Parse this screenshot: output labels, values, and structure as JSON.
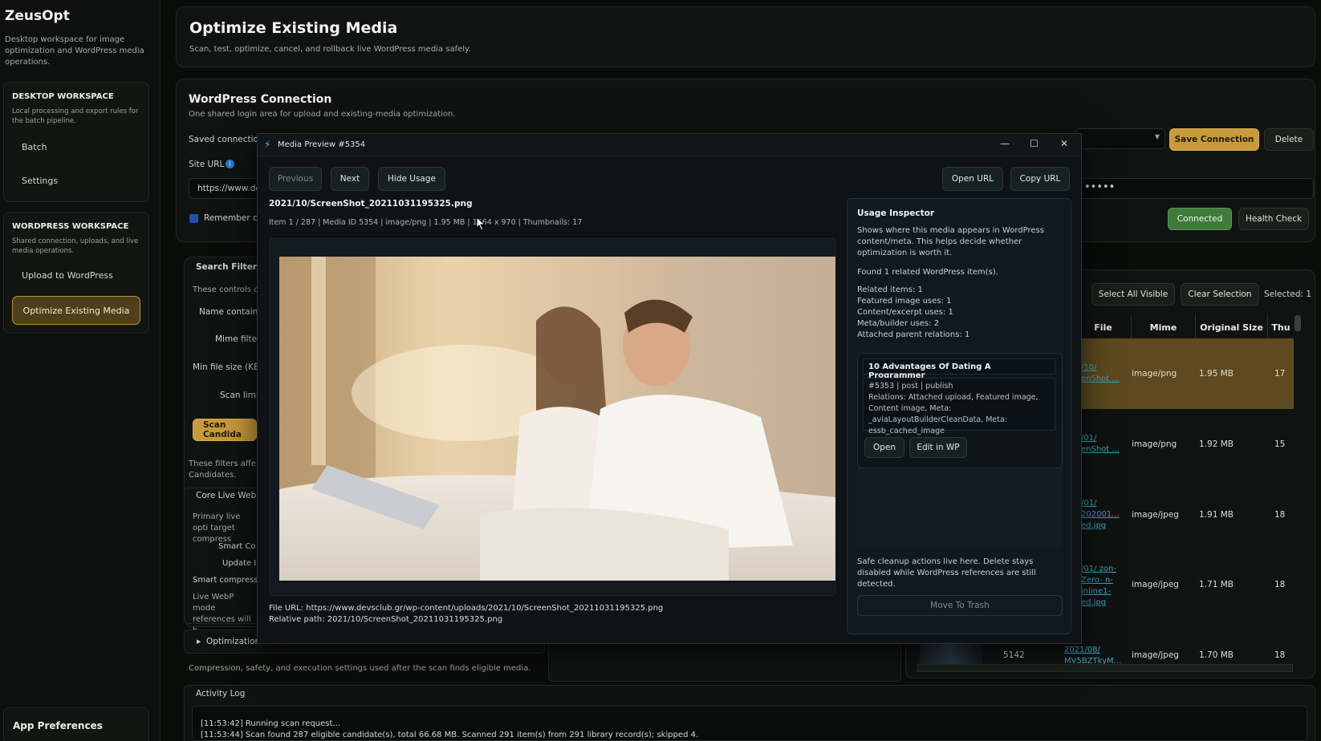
{
  "sidebar": {
    "brand": "ZeusOpt",
    "brand_sub": "Desktop workspace for image optimization and WordPress media operations.",
    "desktop": {
      "heading": "DESKTOP WORKSPACE",
      "desc": "Local processing and export rules for the batch pipeline.",
      "items": [
        "Batch",
        "Settings"
      ]
    },
    "wordpress": {
      "heading": "WORDPRESS WORKSPACE",
      "desc": "Shared connection, uploads, and live media operations.",
      "items": [
        "Upload to WordPress",
        "Optimize Existing Media"
      ]
    },
    "prefs": "App Preferences"
  },
  "header": {
    "title": "Optimize Existing Media",
    "subtitle": "Scan, test, optimize, cancel, and rollback live WordPress media safely."
  },
  "connection": {
    "title": "WordPress Connection",
    "subtitle": "One shared login area for upload and existing-media optimization.",
    "saved_label": "Saved connection",
    "site_url_label": "Site URL",
    "site_url_value": "https://www.de",
    "remember_label": "Remember cr",
    "password_mask": "•••••",
    "save_btn": "Save Connection",
    "delete_btn": "Delete",
    "connected_btn": "Connected",
    "health_btn": "Health Check"
  },
  "filters": {
    "title": "Search Filters",
    "desc": "These controls c",
    "name_label": "Name contains",
    "mime_label": "Mime filter",
    "minsize_label": "Min file size (KB)",
    "scanlimit_label": "Scan limit",
    "scan_btn": "Scan Candida",
    "note": "These filters affe Candidates.",
    "core_title": "Core Live WebP",
    "core_desc": "Primary live opti target compress",
    "smart_label": "Smart Co",
    "update_label": "Update I",
    "smart_compress": "Smart compress",
    "live_webp": "Live WebP mode references will b"
  },
  "rules": {
    "title": "Optimization Rules",
    "desc": "Compression, safety, and execution settings used after the scan finds eligible media."
  },
  "table": {
    "select_all": "Select All Visible",
    "clear": "Clear Selection",
    "selected": "Selected: 1",
    "headers": [
      "File",
      "Mime",
      "Original Size",
      "Thu"
    ],
    "rows": [
      {
        "file": "/10/ enShot ...",
        "mime": "image/png",
        "size": "1.95 MB",
        "thumbs": "17"
      },
      {
        "file": "/01/ enShot ...",
        "mime": "image/png",
        "size": "1.92 MB",
        "thumbs": "15"
      },
      {
        "file": "/01/ 202001... ed.jpg",
        "mime": "image/jpeg",
        "size": "1.91 MB",
        "thumbs": "18"
      },
      {
        "file": "/01/ zon-Zero- n-inline1- ed.jpg",
        "mime": "image/jpeg",
        "size": "1.71 MB",
        "thumbs": "18"
      },
      {
        "id": "5142",
        "file": "2021/08/ MV5BZTkyM...",
        "mime": "image/jpeg",
        "size": "1.70 MB",
        "thumbs": "18"
      }
    ]
  },
  "log": {
    "title": "Activity Log",
    "lines": [
      "[11:53:42] Running scan request...",
      "[11:53:44] Scan found 287 eligible candidate(s), total 66.68 MB. Scanned 291 item(s) from 291 library record(s); skipped 4."
    ]
  },
  "modal": {
    "title": "Media Preview #5354",
    "prev_btn": "Previous",
    "next_btn": "Next",
    "hide_btn": "Hide Usage",
    "open_url_btn": "Open URL",
    "copy_url_btn": "Copy URL",
    "filename": "2021/10/ScreenShot_20211031195325.png",
    "meta": "Item 1 / 287 | Media ID 5354 | image/png | 1.95 MB | 1664 x 970 | Thumbnails: 17",
    "file_url": "File URL: https://www.devsclub.gr/wp-content/uploads/2021/10/ScreenShot_20211031195325.png",
    "rel_path": "Relative path: 2021/10/ScreenShot_20211031195325.png",
    "usage": {
      "title": "Usage Inspector",
      "desc": "Shows where this media appears in WordPress content/meta. This helps decide whether optimization is worth it.",
      "found": "Found 1 related WordPress item(s).",
      "stats": [
        "Related items: 1",
        "Featured image uses: 1",
        "Content/excerpt uses: 1",
        "Meta/builder uses: 2",
        "Attached parent relations: 1"
      ],
      "item_title": "10 Advantages Of Dating A Programmer",
      "item_meta": "#5353 | post | publish",
      "item_rel": "Relations: Attached upload, Featured image, Content image, Meta: _aviaLayoutBuilderCleanData, Meta: essb_cached_image",
      "open_btn": "Open",
      "edit_btn": "Edit in WP",
      "cleanup": "Safe cleanup actions live here. Delete stays disabled while WordPress references are still detected.",
      "trash_btn": "Move To Trash"
    }
  }
}
